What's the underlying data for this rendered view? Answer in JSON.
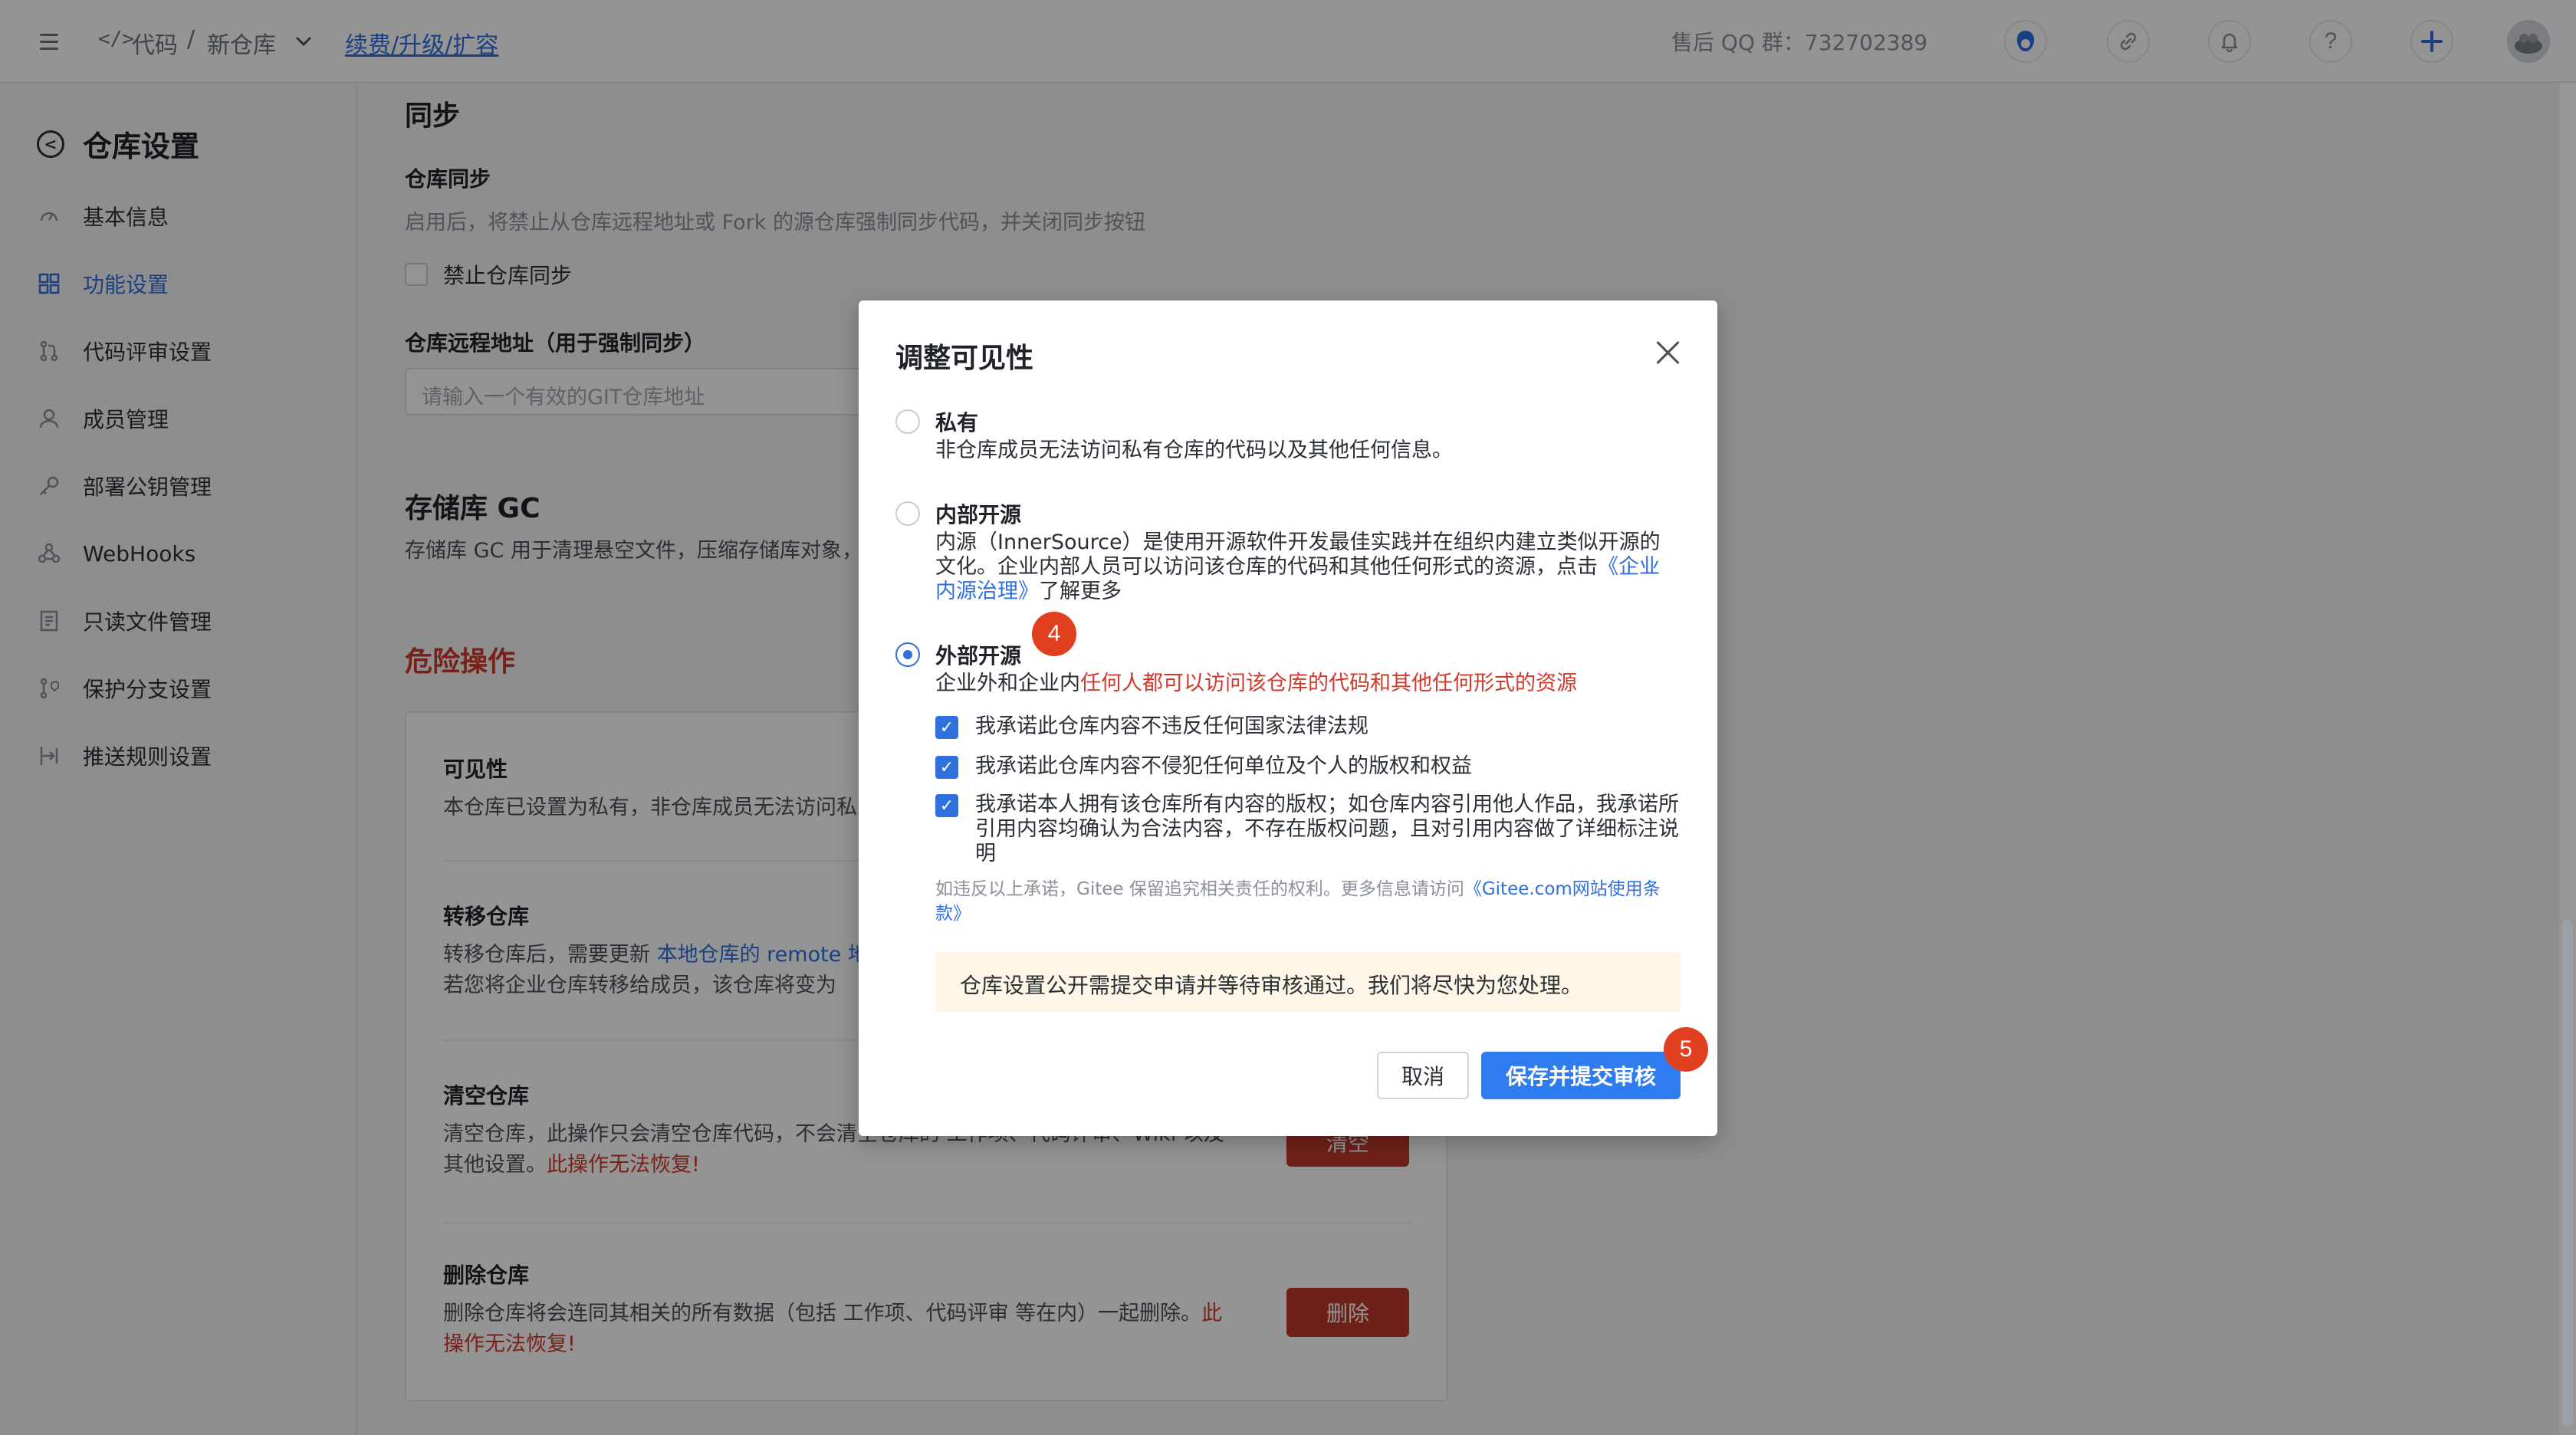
{
  "colors": {
    "accent": "#2f6fde",
    "danger": "#d0392b",
    "badge": "#e0401f",
    "notice_bg": "#fdf6e7"
  },
  "topbar": {
    "breadcrumb_code": "代码",
    "breadcrumb_sep": "/",
    "breadcrumb_repo": "新仓库",
    "renew_link": "续费/升级/扩容",
    "qq_group": "售后 QQ 群：732702389",
    "icons": [
      "menu-icon",
      "code-icon",
      "chevron-down-icon",
      "support-icon",
      "link-icon",
      "bell-icon",
      "help-icon",
      "plus-icon",
      "avatar"
    ]
  },
  "sidebar": {
    "title": "仓库设置",
    "items": [
      {
        "label": "基本信息",
        "icon": "gauge-icon"
      },
      {
        "label": "功能设置",
        "icon": "grid-icon",
        "active": true
      },
      {
        "label": "代码评审设置",
        "icon": "branch-icon"
      },
      {
        "label": "成员管理",
        "icon": "user-icon"
      },
      {
        "label": "部署公钥管理",
        "icon": "key-icon"
      },
      {
        "label": "WebHooks",
        "icon": "webhook-icon"
      },
      {
        "label": "只读文件管理",
        "icon": "file-icon"
      },
      {
        "label": "保护分支设置",
        "icon": "protect-branch-icon"
      },
      {
        "label": "推送规则设置",
        "icon": "push-rule-icon"
      }
    ]
  },
  "main": {
    "sync_title": "同步",
    "repo_sync_label": "仓库同步",
    "repo_sync_desc": "启用后，将禁止从仓库远程地址或 Fork 的源仓库强制同步代码，并关闭同步按钮",
    "disable_sync_label": "禁止仓库同步",
    "remote_url_label": "仓库远程地址（用于强制同步）",
    "remote_url_placeholder": "请输入一个有效的GIT仓库地址",
    "gc_title": "存储库 GC",
    "gc_desc": "存储库 GC 用于清理悬空文件，压缩存储库对象，",
    "danger_title": "危险操作",
    "visibility_title": "可见性",
    "visibility_desc": "本仓库已设置为私有，非仓库成员无法访问私",
    "transfer_title": "转移仓库",
    "transfer_desc_1": "转移仓库后，需要更新 ",
    "transfer_desc_link": "本地仓库的 remote 地",
    "transfer_desc_2": "若您将企业仓库转移给成员，该仓库将变为",
    "clear_title": "清空仓库",
    "clear_desc": "清空仓库，此操作只会清空仓库代码，不会清空仓库的 工作项、代码评审、Wiki 以及其他设置。",
    "clear_warn": "此操作无法恢复!",
    "clear_btn": "清空",
    "delete_title": "删除仓库",
    "delete_desc": "删除仓库将会连同其相关的所有数据（包括 工作项、代码评审 等在内）一起删除。",
    "delete_warn": "此操作无法恢复!",
    "delete_btn": "删除"
  },
  "modal": {
    "title": "调整可见性",
    "options": [
      {
        "label": "私有",
        "desc": "非仓库成员无法访问私有仓库的代码以及其他任何信息。",
        "checked": false
      },
      {
        "label": "内部开源",
        "desc_1": "内源（InnerSource）是使用开源软件开发最佳实践并在组织内建立类似开源的文化。企业内部人员可以访问该仓库的代码和其他任何形式的资源，点击",
        "desc_link": "《企业内源治理》",
        "desc_2": "了解更多",
        "checked": false
      },
      {
        "label": "外部开源",
        "desc_1": "企业外和企业内",
        "desc_red": "任何人都可以访问该仓库的代码和其他任何形式的资源",
        "checked": true
      }
    ],
    "commitments": [
      "我承诺此仓库内容不违反任何国家法律法规",
      "我承诺此仓库内容不侵犯任何单位及个人的版权和权益",
      "我承诺本人拥有该仓库所有内容的版权；如仓库内容引用他人作品，我承诺所引用内容均确认为合法内容，不存在版权问题，且对引用内容做了详细标注说明"
    ],
    "disclaimer_1": "如违反以上承诺，Gitee 保留追究相关责任的权利。更多信息请访问",
    "disclaimer_link": "《Gitee.com网站使用条款》",
    "notice": "仓库设置公开需提交申请并等待审核通过。我们将尽快为您处理。",
    "cancel_label": "取消",
    "save_label": "保存并提交审核"
  },
  "badges": {
    "step4": "4",
    "step5": "5"
  }
}
